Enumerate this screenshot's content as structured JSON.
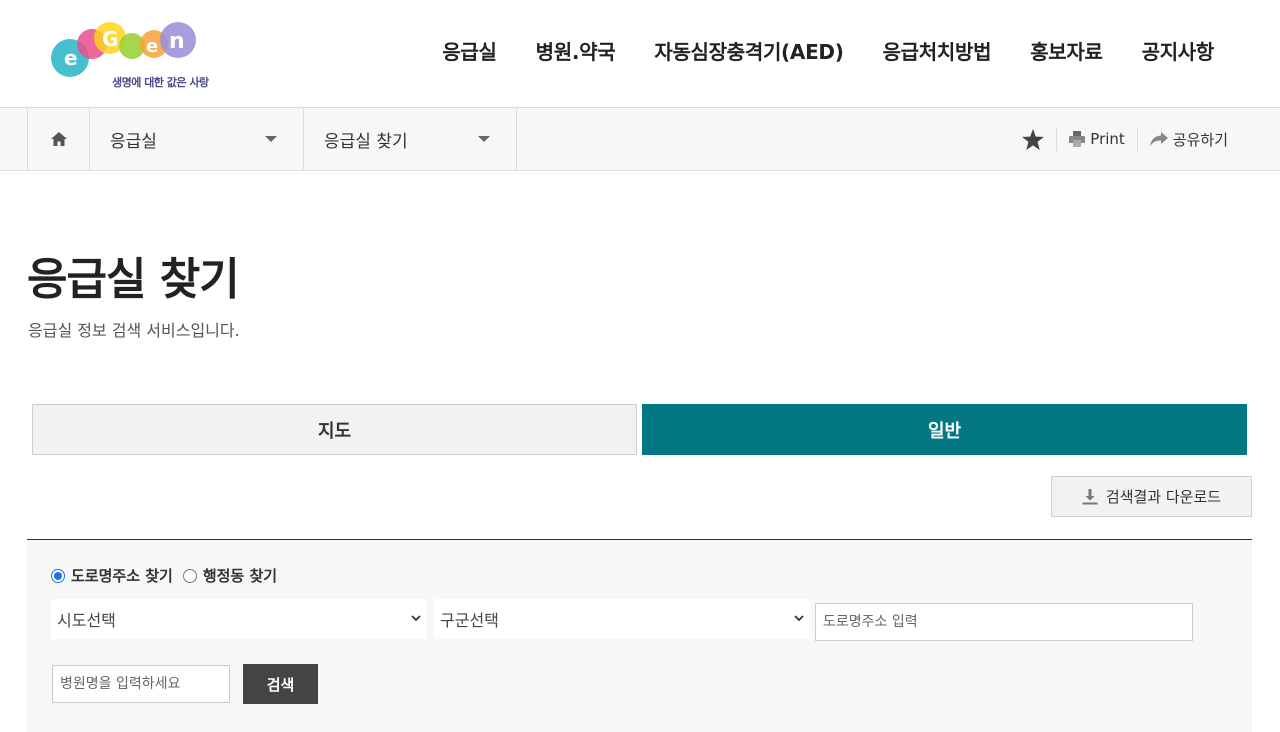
{
  "header": {
    "logo_tagline": "생명에 대한 값은 사랑",
    "nav": [
      "응급실",
      "병원.약국",
      "자동심장충격기(AED)",
      "응급처치방법",
      "홍보자료",
      "공지사항"
    ]
  },
  "subbar": {
    "crumb1": "응급실",
    "crumb2": "응급실 찾기",
    "print_label": "Print",
    "share_label": "공유하기"
  },
  "page": {
    "title": "응급실 찾기",
    "subtitle": "응급실 정보 검색 서비스입니다."
  },
  "tabs": {
    "map": "지도",
    "general": "일반"
  },
  "download_label": "검색결과 다운로드",
  "search": {
    "radio_road": "도로명주소 찾기",
    "radio_admin": "행정동 찾기",
    "sido": "시도선택",
    "gugun": "구군선택",
    "road_placeholder": "도로명주소 입력",
    "hospital_placeholder": "병원명을 입력하세요",
    "search_label": "검색"
  },
  "colors": {
    "accent": "#047785",
    "radio_checked": "#1a73e8"
  }
}
